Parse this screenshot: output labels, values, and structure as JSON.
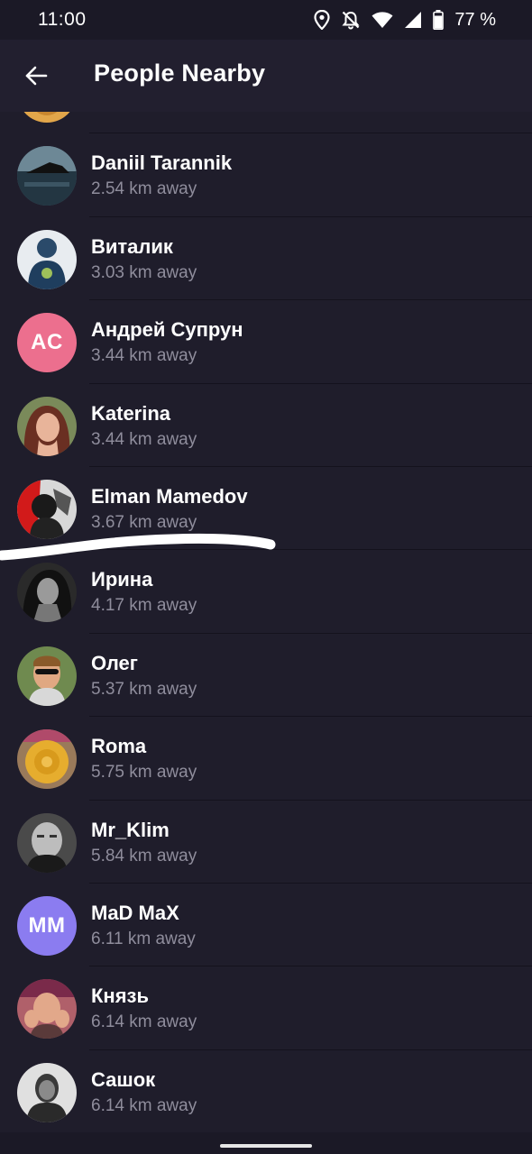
{
  "status_bar": {
    "time": "11:00",
    "battery_percent": "77 %",
    "icons": [
      "location-icon",
      "alarm-off-icon",
      "wifi-icon",
      "signal-icon",
      "battery-icon"
    ]
  },
  "app_bar": {
    "title": "People Nearby",
    "back_icon": "arrow-left-icon"
  },
  "colors": {
    "background": "#1f1d2b",
    "app_bar": "#221f2f",
    "text_primary": "#ffffff",
    "text_secondary": "#8f8d9c"
  },
  "people": [
    {
      "name": "",
      "distance": "",
      "avatar": "photo",
      "avatar_color": "#e2a64a"
    },
    {
      "name": "Daniil Tarannik",
      "distance": "2.54 km away",
      "avatar": "photo",
      "avatar_color": "#2c4150"
    },
    {
      "name": "Виталик",
      "distance": "3.03 km away",
      "avatar": "photo",
      "avatar_color": "#dfe4ea"
    },
    {
      "name": "Андрей Супрун",
      "distance": "3.44 km away",
      "avatar": "initials",
      "initials": "AC",
      "avatar_color": "#ec6f8e"
    },
    {
      "name": "Katerina",
      "distance": "3.44 km away",
      "avatar": "photo",
      "avatar_color": "#a8694f"
    },
    {
      "name": "Elman Mamedov",
      "distance": "3.67 km away",
      "avatar": "photo",
      "avatar_color": "#cfcfcf"
    },
    {
      "name": "Ирина",
      "distance": "4.17 km away",
      "avatar": "photo",
      "avatar_color": "#3a3a3a"
    },
    {
      "name": "Олег",
      "distance": "5.37 km away",
      "avatar": "photo",
      "avatar_color": "#6f8a4f"
    },
    {
      "name": "Roma",
      "distance": "5.75 km away",
      "avatar": "photo",
      "avatar_color": "#d9a030"
    },
    {
      "name": "Mr_Klim",
      "distance": "5.84 km away",
      "avatar": "photo",
      "avatar_color": "#3d3d3d"
    },
    {
      "name": "MaD MaX",
      "distance": "6.11 km away",
      "avatar": "initials",
      "initials": "MM",
      "avatar_color": "#8b7cf0"
    },
    {
      "name": "Князь",
      "distance": "6.14 km away",
      "avatar": "photo",
      "avatar_color": "#b06f73"
    },
    {
      "name": "Сашок",
      "distance": "6.14 km away",
      "avatar": "photo",
      "avatar_color": "#d8d8d8"
    }
  ]
}
